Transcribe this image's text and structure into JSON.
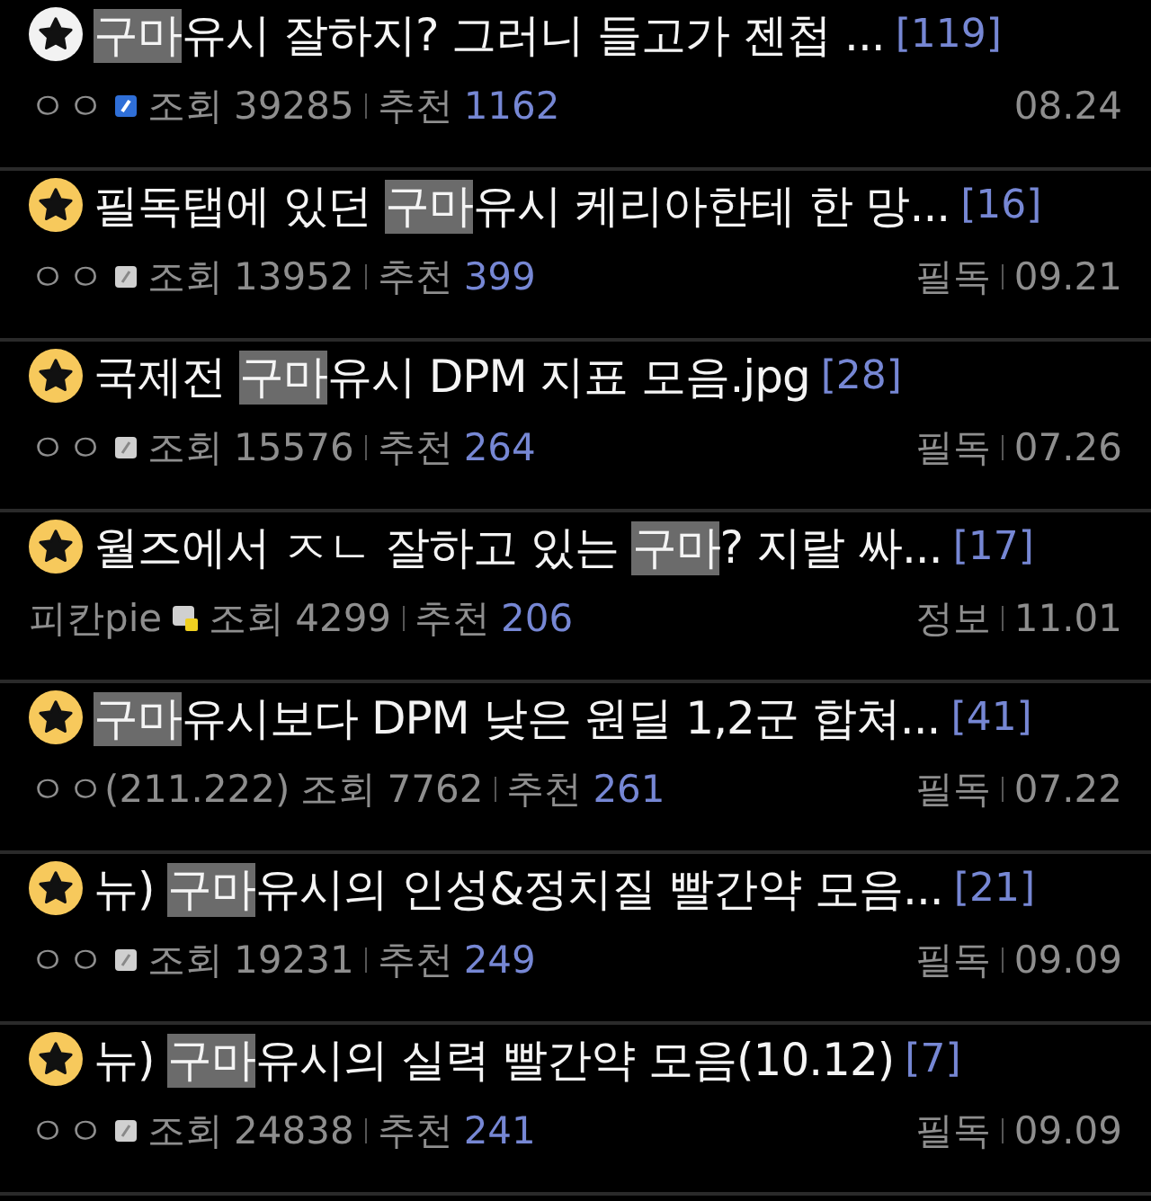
{
  "posts": [
    {
      "kind": "white",
      "highlight": "구마",
      "after": "유시 잘하지? 그러니 들고가 젠첩 ...",
      "comments": "[119]",
      "author": "ㅇㅇ",
      "badge": {
        "kind": "blue"
      },
      "views_label": "조회",
      "views": "39285",
      "recs_label": "추천",
      "recs": "1162",
      "date": "08.24"
    },
    {
      "kind": "gold",
      "before": "필독탭에 있던 ",
      "highlight": "구마",
      "after": "유시 케리아한테 한 망...",
      "comments": "[16]",
      "author": "ㅇㅇ",
      "badge": {
        "kind": "grey"
      },
      "views_label": "조회",
      "views": "13952",
      "recs_label": "추천",
      "recs": "399",
      "category": "필독",
      "date": "09.21"
    },
    {
      "kind": "gold",
      "before": "국제전 ",
      "highlight": "구마",
      "after": "유시 DPM 지표 모음.jpg",
      "comments": "[28]",
      "author": "ㅇㅇ",
      "badge": {
        "kind": "grey"
      },
      "views_label": "조회",
      "views": "15576",
      "recs_label": "추천",
      "recs": "264",
      "category": "필독",
      "date": "07.26"
    },
    {
      "kind": "gold",
      "before": "월즈에서 ㅈㄴ 잘하고 있는 ",
      "highlight": "구마",
      "after": "? 지랄 싸...",
      "comments": "[17]",
      "author": "피칸pie",
      "badge": {
        "kind": "mixed"
      },
      "views_label": "조회",
      "views": "4299",
      "recs_label": "추천",
      "recs": "206",
      "category": "정보",
      "date": "11.01"
    },
    {
      "kind": "gold",
      "highlight": "구마",
      "after": "유시보다 DPM 낮은 원딜 1,2군 합쳐...",
      "comments": "[41]",
      "author": "ㅇㅇ(211.222)",
      "views_label": "조회",
      "views": "7762",
      "recs_label": "추천",
      "recs": "261",
      "category": "필독",
      "date": "07.22"
    },
    {
      "kind": "gold",
      "before": "뉴) ",
      "highlight": "구마",
      "after": "유시의 인성&정치질 빨간약 모음...",
      "comments": "[21]",
      "author": "ㅇㅇ",
      "badge": {
        "kind": "grey"
      },
      "views_label": "조회",
      "views": "19231",
      "recs_label": "추천",
      "recs": "249",
      "category": "필독",
      "date": "09.09"
    },
    {
      "kind": "gold",
      "before": "뉴) ",
      "highlight": "구마",
      "after": "유시의 실력 빨간약 모음(10.12)",
      "comments": "[7]",
      "author": "ㅇㅇ",
      "badge": {
        "kind": "grey"
      },
      "views_label": "조회",
      "views": "24838",
      "recs_label": "추천",
      "recs": "241",
      "category": "필독",
      "date": "09.09"
    }
  ]
}
